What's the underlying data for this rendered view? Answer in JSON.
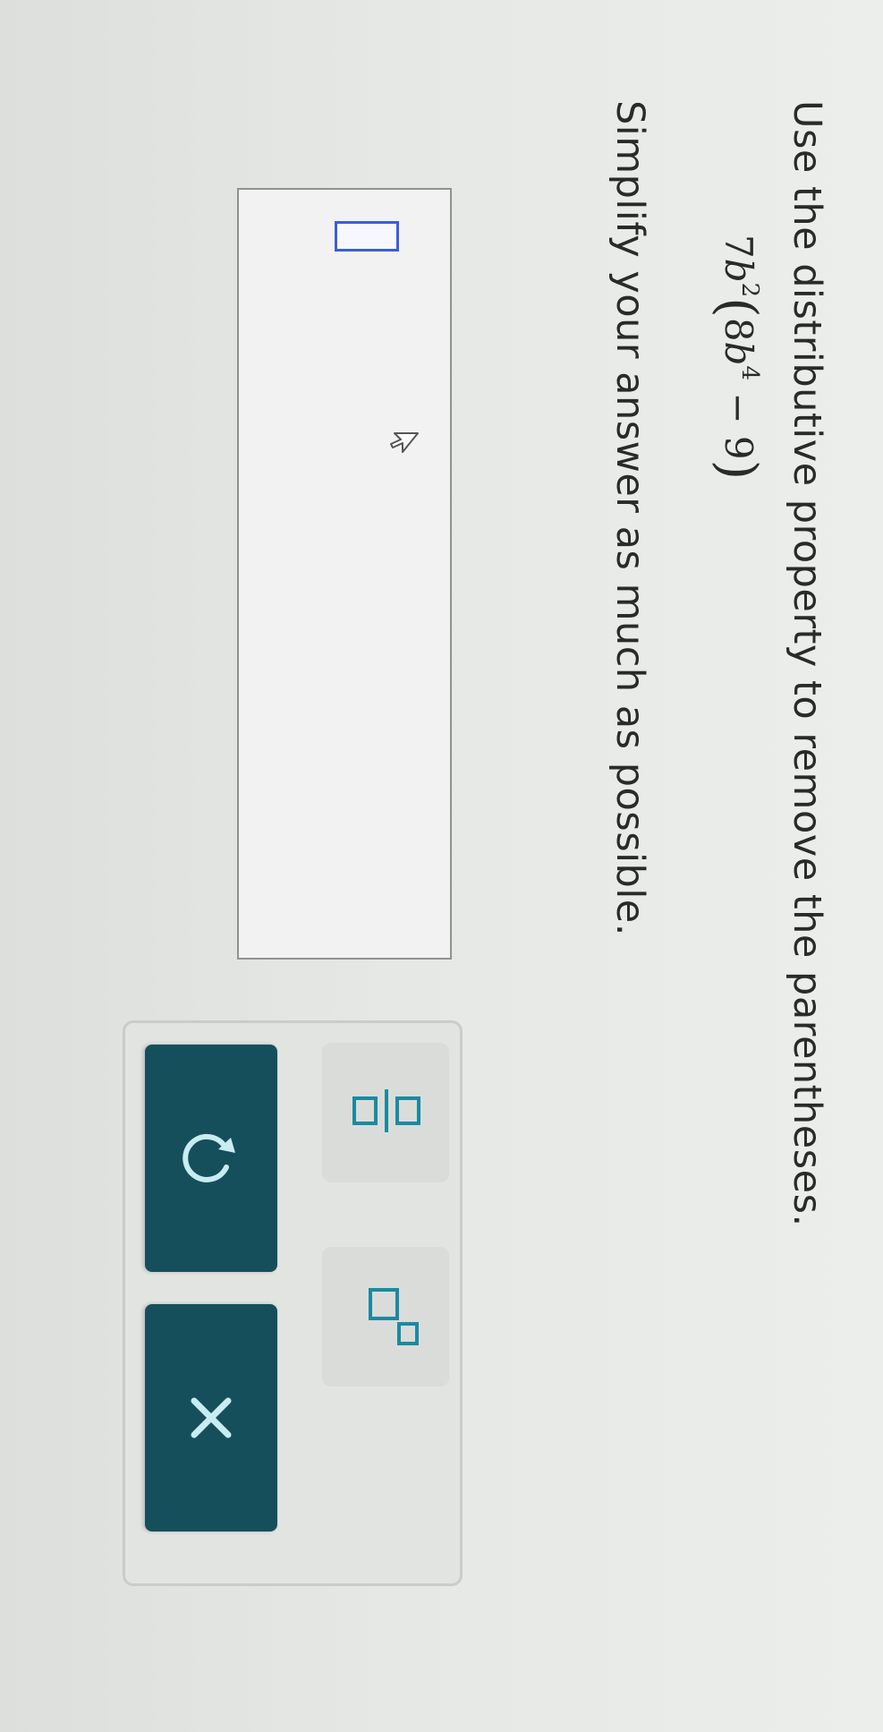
{
  "question": {
    "instruction": "Use the distributive property to remove the parentheses.",
    "expression": {
      "coefficient": "7",
      "base": "b",
      "exponent": "2",
      "inner_coefficient": "8",
      "inner_base": "b",
      "inner_exponent": "4",
      "operator": "−",
      "constant": "9"
    },
    "instruction2": "Simplify your answer as much as possible."
  },
  "answer": {
    "value": ""
  },
  "toolbar": {
    "tools": [
      {
        "icon": "fraction-icon"
      },
      {
        "icon": "exponent-icon"
      }
    ],
    "actions": [
      {
        "icon": "undo-icon"
      },
      {
        "icon": "clear-icon"
      }
    ]
  },
  "colors": {
    "accent": "#164f5c",
    "input_border": "#3b5ed8",
    "icon_teal": "#1b8aa0",
    "text": "#2a2a2a"
  }
}
